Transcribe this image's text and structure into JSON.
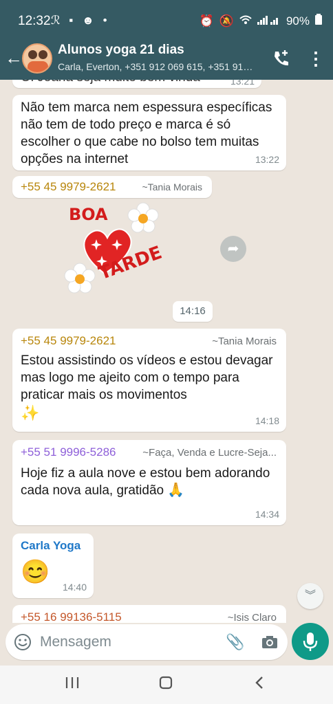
{
  "status": {
    "time": "12:32",
    "battery": "90%",
    "left_icons": "ℛ ▪ ☻ •"
  },
  "header": {
    "title": "Alunos yoga 21 dias",
    "subtitle": "Carla, Everton, +351 912 069 615, +351 91…"
  },
  "messages": [
    {
      "partial_text": "Ol Joana seja muito bem vinda",
      "time": "13:21"
    },
    {
      "text": "Não tem marca nem espessura específicas não tem de todo preço e marca é só escolher o que cabe no bolso tem muitas opções na internet",
      "time": "13:22"
    },
    {
      "sender": "+55 45 9979-2621",
      "alias": "~Tania Morais",
      "sticker": {
        "line1": "BOA",
        "line2": "TARDE"
      }
    },
    {
      "sender": "+55 45 9979-2621",
      "alias": "~Tania Morais",
      "text": "Estou assistindo os vídeos e estou devagar mas logo me ajeito com o tempo para praticar mais os movimentos",
      "emoji": "✨",
      "time": "14:18"
    },
    {
      "sender": "+55 51 9996-5286",
      "alias": "~Faça, Venda e Lucre-Seja...",
      "text": "Hoje fiz a aula nove e estou bem adorando cada nova aula, gratidão",
      "emoji": "🙏",
      "time": "14:34"
    },
    {
      "sender": "Carla Yoga",
      "emoji": "😊",
      "time": "14:40"
    },
    {
      "sender": "+55 16 99136-5115",
      "alias": "~Isis Claro"
    }
  ],
  "day_chip": "14:16",
  "input": {
    "placeholder": "Mensagem"
  },
  "colors": {
    "header": "#355a63",
    "chat_bg": "#ece5dd",
    "sender_tania": "#b8860b",
    "sender_purple": "#8e5fd9",
    "sender_carla": "#1f78c8",
    "sender_isis": "#c4572a",
    "mic": "#0f9a88"
  }
}
